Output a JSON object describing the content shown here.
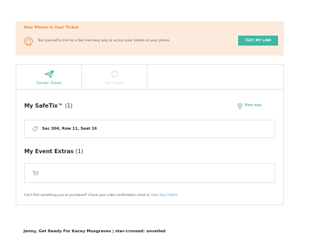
{
  "banner": {
    "title": "Your Phone Is Your Ticket",
    "text": "Text yourself a link for a fast and easy way to access your tickets on your phone.",
    "button_label": "TEXT MY LINK"
  },
  "tabs": [
    {
      "label": "Transfer Tickets"
    },
    {
      "label": "Sell Tickets"
    }
  ],
  "safetix": {
    "title": "My SafeTix™",
    "count": "(1)",
    "view_map_label": "View map",
    "seat": "Sec 304, Row 11, Seat 16"
  },
  "extras": {
    "title": "My Event Extras",
    "count": "(1)"
  },
  "help": {
    "text": "Can't find something you've purchased? Check your order confirmation email or ",
    "link": "View Your Orders",
    "end": "."
  },
  "event_heading": "Jenny, Get Ready For Kacey Musgraves | star-crossed: unveiled",
  "colors": {
    "accent": "#3fb8a3",
    "banner_bg": "#fcebdd",
    "banner_title": "#e58a3b",
    "link": "#5a8fd8"
  }
}
